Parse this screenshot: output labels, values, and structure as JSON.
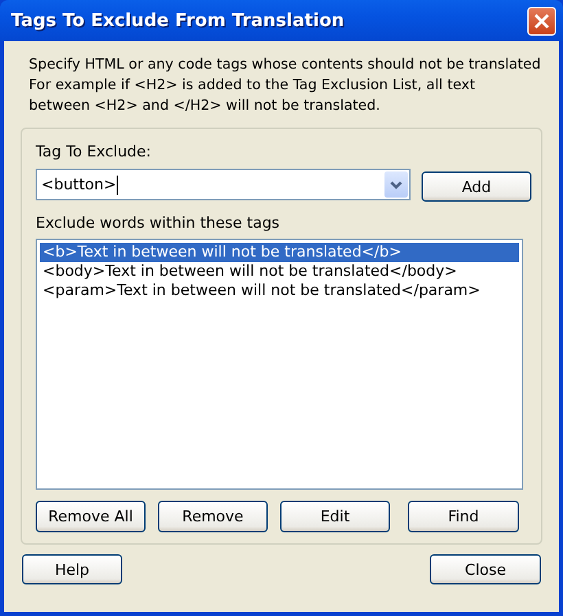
{
  "window": {
    "title": "Tags To Exclude From Translation"
  },
  "description": [
    "Specify HTML or any code tags whose contents should not be translated",
    "For example if <H2> is added to the Tag Exclusion List, all text",
    "between <H2> and </H2> will not be translated."
  ],
  "tag_field": {
    "label": "Tag To Exclude:",
    "value": "<button>"
  },
  "add_button": "Add",
  "list": {
    "label": "Exclude words within these tags",
    "items": [
      {
        "text": "<b>Text in between will not be translated</b>",
        "selected": true
      },
      {
        "text": "<body>Text in between will not be translated</body>",
        "selected": false
      },
      {
        "text": "<param>Text in between will not be translated</param>",
        "selected": false
      }
    ]
  },
  "list_buttons": [
    "Remove All",
    "Remove",
    "Edit",
    "Find"
  ],
  "footer_buttons": [
    "Help",
    "Close"
  ]
}
